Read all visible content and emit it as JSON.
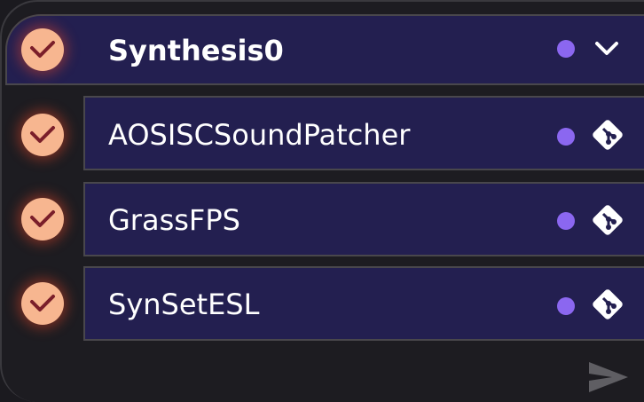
{
  "group": {
    "name": "Synthesis0",
    "checked": true,
    "status_color": "#8b67f0",
    "expanded_icon": "chevron-down-icon"
  },
  "items": [
    {
      "label": "AOSISCSoundPatcher",
      "checked": true,
      "status_color": "#8b67f0",
      "source_icon": "git-icon"
    },
    {
      "label": "GrassFPS",
      "checked": true,
      "status_color": "#8b67f0",
      "source_icon": "git-icon"
    },
    {
      "label": "SynSetESL",
      "checked": true,
      "status_color": "#8b67f0",
      "source_icon": "git-icon"
    }
  ],
  "footer": {
    "send_icon": "send-icon"
  },
  "colors": {
    "background": "#1d1c21",
    "row_background": "#231f50",
    "row_border": "#49474c",
    "check_fill": "#f7b690",
    "check_mark": "#7a1e2a",
    "status_dot": "#8b67f0",
    "send_icon": "#5f5e63"
  }
}
